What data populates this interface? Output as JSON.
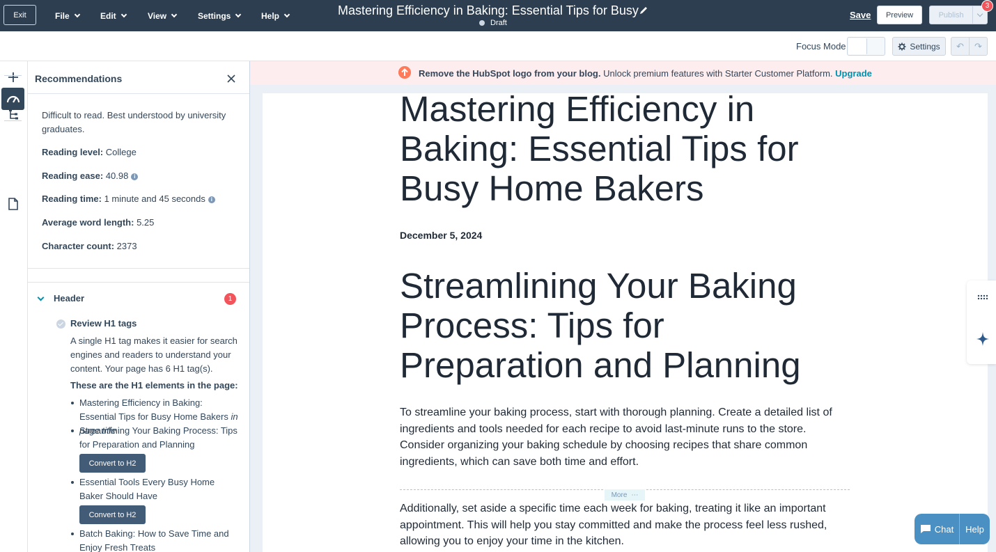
{
  "topbar": {
    "exit_label": "Exit",
    "menus": [
      "File",
      "Edit",
      "View",
      "Settings",
      "Help"
    ],
    "doc_title": "Mastering Efficiency in Baking: Essential Tips for Busy",
    "status": "Draft",
    "save_label": "Save",
    "preview_label": "Preview",
    "publish_label": "Publish",
    "notification_count": "3"
  },
  "toolbar": {
    "focus_mode_label": "Focus Mode",
    "settings_label": "Settings"
  },
  "rail": {
    "icons": [
      "plus-icon",
      "tree-structure-icon",
      "gauge-icon",
      "page-icon"
    ]
  },
  "recommendations": {
    "title": "Recommendations",
    "summary": "Difficult to read. Best understood by university graduates.",
    "stats": [
      {
        "label": "Reading level:",
        "value": "College"
      },
      {
        "label": "Reading ease:",
        "value": "40.98"
      },
      {
        "label": "Reading time:",
        "value": "1 minute and 45 seconds"
      },
      {
        "label": "Average word length:",
        "value": "5.25"
      },
      {
        "label": "Character count:",
        "value": "2373"
      }
    ],
    "section": {
      "title": "Header",
      "badge": "1",
      "rec_title": "Review H1 tags",
      "rec_desc": "A single H1 tag makes it easier for search engines and readers to understand your content. Your page has 6 H1 tag(s).",
      "list_heading": "These are the H1 elements in the page:",
      "items": [
        {
          "text": "Mastering Efficiency in Baking: Essential Tips for Busy Home Bakers",
          "note": "in page title"
        },
        {
          "text": "Streamlining Your Baking Process: Tips for Preparation and Planning",
          "button": "Convert to H2"
        },
        {
          "text": "Essential Tools Every Busy Home Baker Should Have",
          "button": "Convert to H2"
        },
        {
          "text": "Batch Baking: How to Save Time and Enjoy Fresh Treats"
        }
      ]
    }
  },
  "banner": {
    "bold_text": "Remove the HubSpot logo from your blog.",
    "text": "Unlock premium features with Starter Customer Platform.",
    "link": "Upgrade"
  },
  "post": {
    "title": "Mastering Efficiency in Baking: Essential Tips for Busy Home Bakers",
    "date": "December 5, 2024",
    "heading": "Streamlining Your Baking Process: Tips for Preparation and Planning",
    "para1": "To streamline your baking process, start with thorough planning. Create a detailed list of ingredients and tools needed for each recipe to avoid last-minute runs to the store. Consider organizing your baking schedule by choosing recipes that share common ingredients, which can save both time and effort.",
    "more_label": "More",
    "para2": "Additionally, set aside a specific time each week for baking, treating it like an important appointment. This will help you stay committed and make the process feel less rushed, allowing you to enjoy your time in the kitchen."
  },
  "chat": {
    "chat_label": "Chat",
    "help_label": "Help"
  },
  "colors": {
    "topbar": "#2d3e50",
    "accent": "#0091ae",
    "alert": "#f2545b",
    "orange": "#ff7a59",
    "chat": "#4a90c2"
  }
}
